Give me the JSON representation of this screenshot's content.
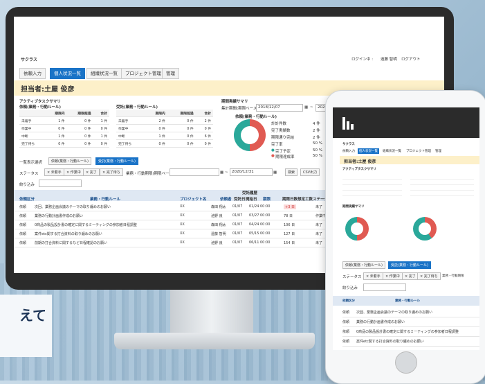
{
  "app": {
    "name": "サクラス",
    "login_info": "ログイン中 :",
    "user_name": "遠藤 智明",
    "logout": "ログアウト"
  },
  "tabs": [
    "依頼入力",
    "個人状況一覧",
    "組織状況一覧",
    "プロジェクト管理",
    "管理"
  ],
  "assignee_label": "担当者:土屋 俊彦",
  "summary": {
    "title": "アクティブタスクサマリ",
    "table1_caption": "依頼(業務・行動ルール)",
    "table2_caption": "受託(業務・行動ルール)",
    "headers": [
      "",
      "期限内",
      "期限超過",
      "合計"
    ],
    "rows1": [
      [
        "未着手",
        "1 件",
        "0 件",
        "1 件"
      ],
      [
        "作業中",
        "0 件",
        "0 件",
        "0 件"
      ],
      [
        "中断",
        "1 件",
        "0 件",
        "1 件"
      ],
      [
        "完了待ち",
        "0 件",
        "0 件",
        "0 件"
      ]
    ],
    "rows2": [
      [
        "未着手",
        "2 件",
        "0 件",
        "2 件"
      ],
      [
        "作業中",
        "0 件",
        "0 件",
        "0 件"
      ],
      [
        "中断",
        "1 件",
        "0 件",
        "6 件"
      ],
      [
        "完了待ち",
        "0 件",
        "0 件",
        "0 件"
      ]
    ]
  },
  "period": {
    "title": "期間実績サマリ",
    "range_label": "集計期間(期限ベース)",
    "from": "2018/12/07",
    "tilde": "~",
    "to": "2020/1",
    "chart_caption": "依頼(業務・行動ルール)",
    "legend": [
      [
        "計計件数",
        "4 件"
      ],
      [
        "完了実績数",
        "2 件"
      ],
      [
        "期限通り完結",
        "2 件"
      ],
      [
        "完了率",
        "50 %"
      ]
    ],
    "legend2": [
      [
        "完了予定",
        "50 %"
      ],
      [
        "期限達成率",
        "50 %"
      ]
    ]
  },
  "list": {
    "mode_label": "一覧表示選択",
    "mode_tabs": [
      "依頼(業務・行動ルール)",
      "受託(業務・行動ルール)"
    ],
    "status_label": "ステータス",
    "status_chips": [
      "× 未着手",
      "× 作業中",
      "× 完了",
      "× 完了待ち"
    ],
    "date_label": "業務・行動期限(期限ベース)",
    "date_to": "2020/12/31",
    "search": "検索",
    "csv": "CSV出力",
    "filter_label": "絞り込み",
    "group_label": "受託履歴",
    "headers": [
      "依頼区分",
      "業務・行動ルール",
      "プロジェクト名",
      "依頼者",
      "受託日",
      "開始日",
      "期限",
      "期限日数",
      "想定工数",
      "ステータス"
    ],
    "rows": [
      [
        "依頼",
        "次回、業務企画会議のテーマの取り纏めのお願い",
        "XX",
        "森田 翔太",
        "01/07",
        "01/24 00:00",
        "+3 日",
        "未了"
      ],
      [
        "依頼",
        "業務の行動計画書作成のお願い",
        "XX",
        "池野 良",
        "01/07",
        "03/27 00:00",
        "78 日",
        "作業中"
      ],
      [
        "依頼",
        "0商品の製品設計書の確定に関するミーティングの参加者日程調整",
        "XX",
        "森田 翔太",
        "01/07",
        "04/24 00:00",
        "106 日",
        "未了"
      ],
      [
        "依頼",
        "案件etc関する打合資料の取り纏めのお願い",
        "XX",
        "遠藤 智明",
        "01/07",
        "05/15 00:00",
        "127 日",
        "未了"
      ],
      [
        "依頼",
        "前期の打合資料に関するなど日程確認のお願い",
        "XX",
        "池野 良",
        "01/07",
        "06/11 00:00",
        "154 日",
        "未了"
      ]
    ]
  },
  "caption": "えて",
  "phone": {
    "app": "サクラス",
    "tabs": [
      "依頼入力",
      "個人状況一覧",
      "組織状況一覧",
      "プロジェクト管理",
      "管理"
    ],
    "assignee": "担当者:土屋 俊彦",
    "summary_title": "アクティブタスクサマリ",
    "period_title": "期間実績サマリ",
    "mode_tabs": [
      "依頼(業務・行動ルール)",
      "受託(業務・行動ルール)"
    ],
    "status_label": "ステータス",
    "chips": [
      "× 未着手",
      "× 作業中",
      "× 完了",
      "× 完了待ち"
    ],
    "date_label": "業務・行動期限",
    "filter_label": "絞り込み",
    "headers": [
      "依頼区分",
      "業務・行動ルール"
    ],
    "rows": [
      [
        "依頼",
        "次回、業務企画会議のテーマの取り纏めのお願い"
      ],
      [
        "依頼",
        "業務の行動計画書作成のお願い"
      ],
      [
        "依頼",
        "0商品の製品設計書の確定に関するミーティングの参加者日程調整"
      ],
      [
        "依頼",
        "案件etc関する打合資料の取り纏めのお願い"
      ],
      [
        "依頼",
        "前期の打合資料に関するなど日程確認のお願い"
      ]
    ]
  },
  "colors": {
    "accent": "#1a73c7",
    "band": "#fdf0c9",
    "donut_red": "#e05a52",
    "donut_teal": "#2aa89a",
    "monitor": "#2b2b2b"
  }
}
